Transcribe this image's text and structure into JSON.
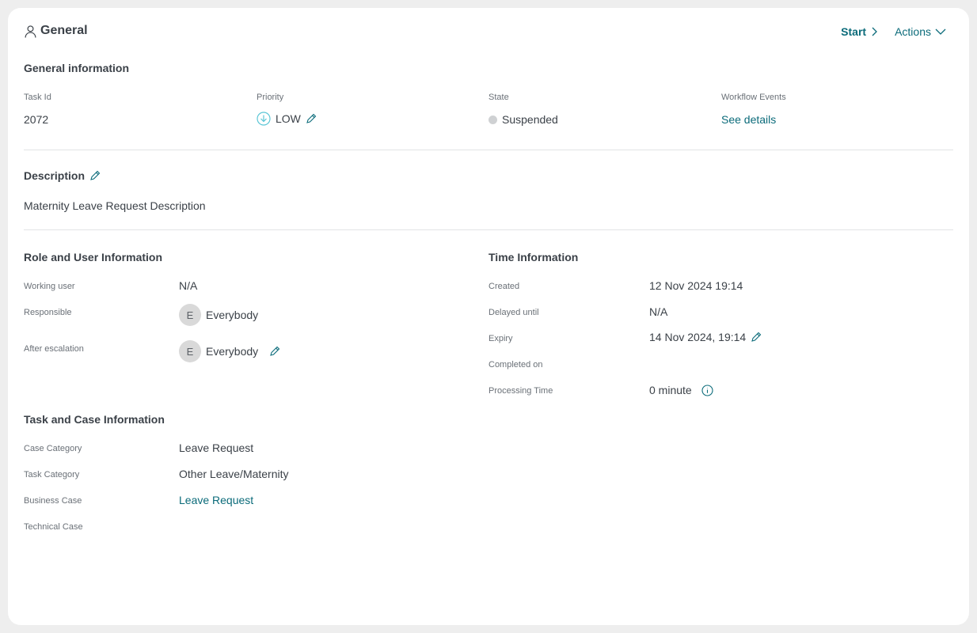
{
  "header": {
    "title": "General",
    "start_label": "Start",
    "actions_label": "Actions"
  },
  "general": {
    "title": "General information",
    "task_id_label": "Task Id",
    "task_id": "2072",
    "priority_label": "Priority",
    "priority": "LOW",
    "state_label": "State",
    "state": "Suspended",
    "workflow_label": "Workflow Events",
    "workflow_link": "See details"
  },
  "description": {
    "title": "Description",
    "text": "Maternity Leave Request Description"
  },
  "role": {
    "title": "Role and User Information",
    "working_user_label": "Working user",
    "working_user": "N/A",
    "responsible_label": "Responsible",
    "responsible_initial": "E",
    "responsible": "Everybody",
    "after_escalation_label": "After escalation",
    "after_escalation_initial": "E",
    "after_escalation": "Everybody"
  },
  "time": {
    "title": "Time Information",
    "created_label": "Created",
    "created": "12 Nov 2024 19:14",
    "delayed_label": "Delayed until",
    "delayed": "N/A",
    "expiry_label": "Expiry",
    "expiry": "14 Nov 2024, 19:14",
    "completed_label": "Completed on",
    "processing_label": "Processing Time",
    "processing": "0 minute"
  },
  "task_case": {
    "title": "Task and Case Information",
    "case_category_label": "Case Category",
    "case_category": "Leave Request",
    "task_category_label": "Task Category",
    "task_category": "Other Leave/Maternity",
    "business_case_label": "Business Case",
    "business_case": "Leave Request",
    "technical_case_label": "Technical Case"
  },
  "colors": {
    "accent": "#0b6b7a",
    "priority_low": "#5bc6d6",
    "state_dot": "#cfd1d3"
  }
}
